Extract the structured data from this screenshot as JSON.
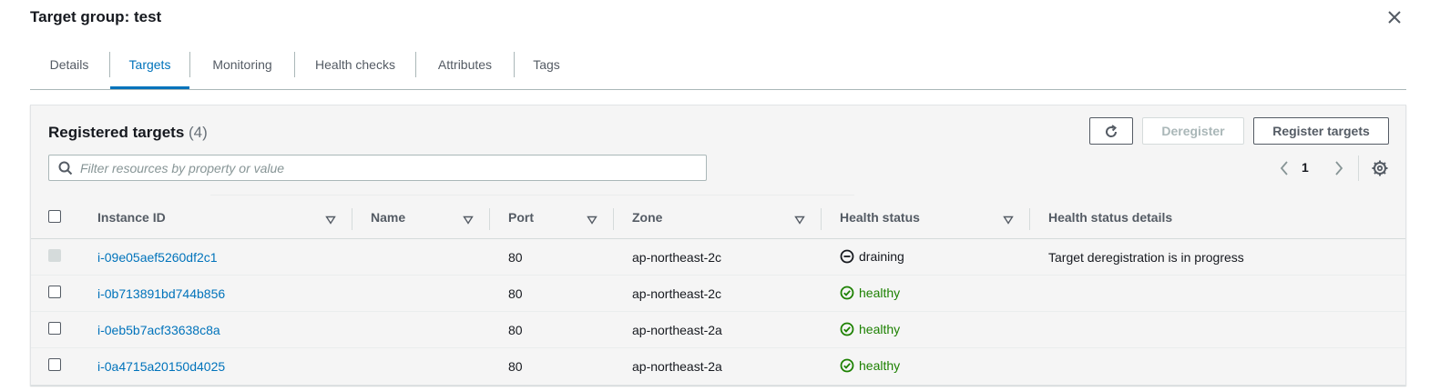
{
  "title": "Target group: test",
  "tabs": [
    {
      "label": "Details"
    },
    {
      "label": "Targets"
    },
    {
      "label": "Monitoring"
    },
    {
      "label": "Health checks"
    },
    {
      "label": "Attributes"
    },
    {
      "label": "Tags"
    }
  ],
  "active_tab": "Targets",
  "panel": {
    "title": "Registered targets",
    "count": "(4)",
    "refresh_icon": "refresh-icon",
    "deregister_label": "Deregister",
    "register_label": "Register targets",
    "filter_placeholder": "Filter resources by property or value",
    "page": "1"
  },
  "columns": {
    "instance_id": "Instance ID",
    "name": "Name",
    "port": "Port",
    "zone": "Zone",
    "health_status": "Health status",
    "health_status_details": "Health status details"
  },
  "rows": [
    {
      "instance_id": "i-09e05aef5260df2c1",
      "name": "",
      "port": "80",
      "zone": "ap-northeast-2c",
      "status": "draining",
      "status_icon": "minus-circle-icon",
      "details": "Target deregistration is in progress",
      "checkbox_disabled": true
    },
    {
      "instance_id": "i-0b713891bd744b856",
      "name": "",
      "port": "80",
      "zone": "ap-northeast-2c",
      "status": "healthy",
      "status_icon": "check-circle-icon",
      "details": "",
      "checkbox_disabled": false
    },
    {
      "instance_id": "i-0eb5b7acf33638c8a",
      "name": "",
      "port": "80",
      "zone": "ap-northeast-2a",
      "status": "healthy",
      "status_icon": "check-circle-icon",
      "details": "",
      "checkbox_disabled": false
    },
    {
      "instance_id": "i-0a4715a20150d4025",
      "name": "",
      "port": "80",
      "zone": "ap-northeast-2a",
      "status": "healthy",
      "status_icon": "check-circle-icon",
      "details": "",
      "checkbox_disabled": false
    }
  ],
  "colors": {
    "link": "#0073bb",
    "healthy": "#1d8102",
    "text": "#16191f",
    "muted": "#545b64"
  }
}
